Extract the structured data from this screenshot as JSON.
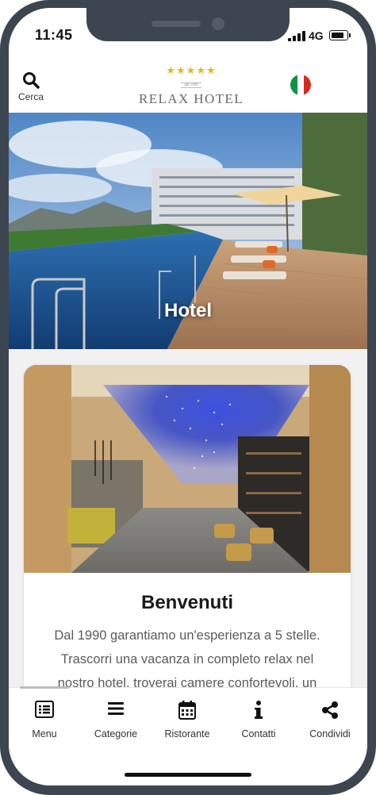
{
  "status_bar": {
    "time": "11:45",
    "network": "4G",
    "icons": [
      "signal-icon",
      "battery-icon"
    ]
  },
  "header": {
    "search_label": "Cerca",
    "search_icon": "search-icon",
    "logo": {
      "stars": "★★★★★",
      "established": "dal 1990",
      "name": "RELAX HOTEL"
    },
    "language_flag": "italy-flag-icon",
    "flag_colors": [
      "#0b9446",
      "#ffffff",
      "#d52b1e"
    ]
  },
  "hero": {
    "title": "Hotel"
  },
  "card": {
    "title": "Benvenuti",
    "text": "Dal 1990 garantiamo un'esperienza a 5 stelle. Trascorri una vacanza in completo relax nel nostro hotel, troverai camere confortevoli, un"
  },
  "bottom_nav": {
    "items": [
      {
        "label": "Menu",
        "icon": "menu-list-icon"
      },
      {
        "label": "Categorie",
        "icon": "categories-icon"
      },
      {
        "label": "Ristorante",
        "icon": "calendar-icon"
      },
      {
        "label": "Contatti",
        "icon": "info-icon"
      },
      {
        "label": "Condividi",
        "icon": "share-icon"
      }
    ]
  },
  "colors": {
    "frame": "#3d4650",
    "accent_gold": "#e3b428",
    "text_dark": "#1a1a1a",
    "text_body": "#5b5b5b",
    "content_bg": "#f1f1f1"
  }
}
